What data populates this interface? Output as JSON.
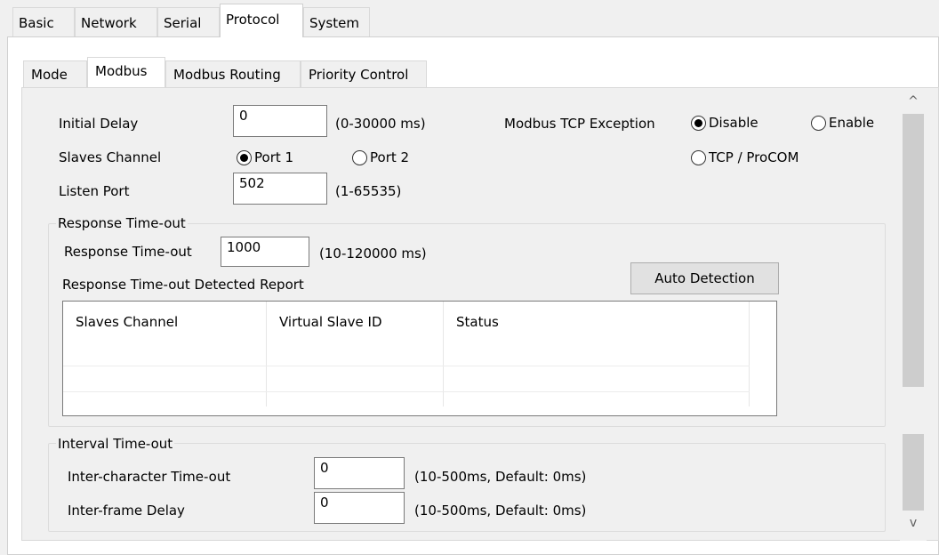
{
  "main_tabs": [
    "Basic",
    "Network",
    "Serial",
    "Protocol",
    "System"
  ],
  "sub_tabs": [
    "Mode",
    "Modbus",
    "Modbus Routing",
    "Priority Control"
  ],
  "form": {
    "initial_delay": {
      "label": "Initial Delay",
      "value": "0",
      "hint": "(0-30000 ms)"
    },
    "slaves_channel": {
      "label": "Slaves Channel",
      "options": [
        "Port 1",
        "Port 2"
      ],
      "selected": "Port 1"
    },
    "listen_port": {
      "label": "Listen Port",
      "value": "502",
      "hint": "(1-65535)"
    },
    "tcp_exception": {
      "label": "Modbus TCP Exception",
      "options": [
        "Disable",
        "Enable",
        "TCP / ProCOM"
      ],
      "selected": "Disable"
    }
  },
  "response_group": {
    "title": "Response Time-out",
    "timeout_label": "Response Time-out",
    "timeout_value": "1000",
    "timeout_hint": "(10-120000 ms)",
    "report_label": "Response Time-out Detected Report",
    "auto_detection": "Auto Detection",
    "table_headers": [
      "Slaves Channel",
      "Virtual Slave ID",
      "Status"
    ]
  },
  "interval_group": {
    "title": "Interval Time-out",
    "inter_char_label": "Inter-character Time-out",
    "inter_char_value": "0",
    "inter_char_hint": "(10-500ms, Default: 0ms)",
    "inter_frame_label": "Inter-frame Delay",
    "inter_frame_value": "0",
    "inter_frame_hint": "(10-500ms, Default: 0ms)"
  },
  "scroll": {
    "up": "^",
    "down": "v"
  }
}
